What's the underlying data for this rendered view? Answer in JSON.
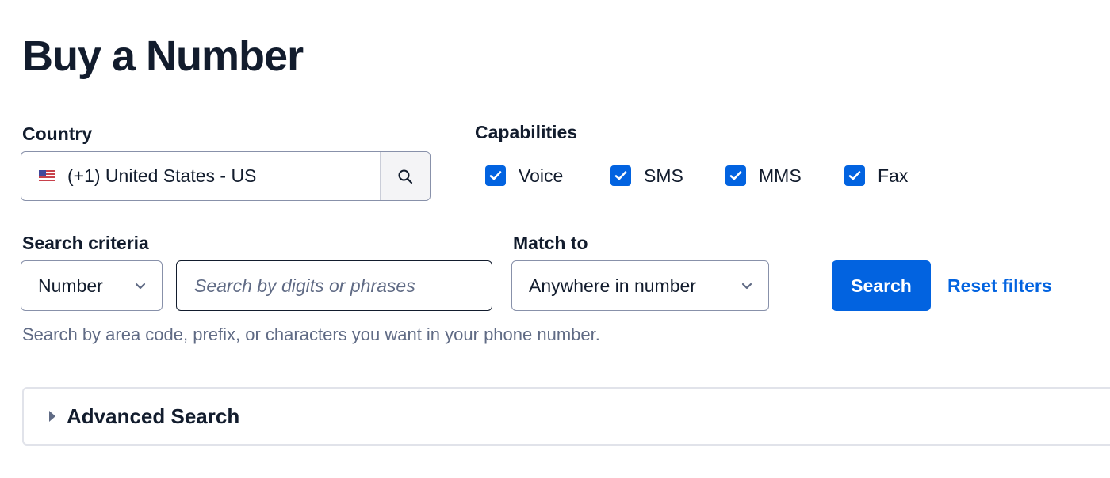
{
  "page": {
    "title": "Buy a Number"
  },
  "country": {
    "label": "Country",
    "value": "(+1) United States - US",
    "flag_icon": "us-flag-icon",
    "search_icon": "search-icon"
  },
  "capabilities": {
    "label": "Capabilities",
    "items": [
      {
        "label": "Voice",
        "checked": true
      },
      {
        "label": "SMS",
        "checked": true
      },
      {
        "label": "MMS",
        "checked": true
      },
      {
        "label": "Fax",
        "checked": true
      }
    ]
  },
  "search_criteria": {
    "label": "Search criteria",
    "type_value": "Number",
    "input_value": "",
    "input_placeholder": "Search by digits or phrases",
    "help_text": "Search by area code, prefix, or characters you want in your phone number."
  },
  "match_to": {
    "label": "Match to",
    "value": "Anywhere in number"
  },
  "actions": {
    "search_label": "Search",
    "reset_label": "Reset filters"
  },
  "advanced_search": {
    "label": "Advanced Search",
    "expanded": false
  },
  "colors": {
    "accent": "#0263e0",
    "text": "#121c2d",
    "muted": "#606b85",
    "border": "#8891aa"
  }
}
